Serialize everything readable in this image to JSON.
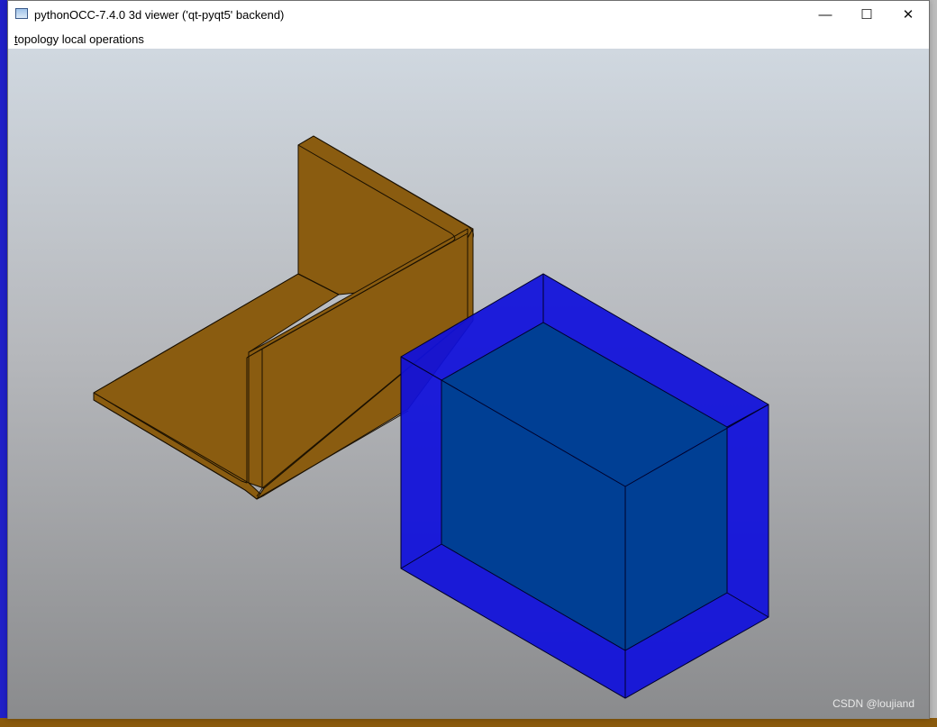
{
  "window": {
    "title": "pythonOCC-7.4.0 3d viewer ('qt-pyqt5' backend)",
    "controls": {
      "minimize": "—",
      "maximize": "☐",
      "close": "✕"
    }
  },
  "menubar": {
    "items": [
      {
        "mnemonic": "t",
        "rest": "opology local operations"
      }
    ]
  },
  "viewport": {
    "colors": {
      "bracket_face": "#8a5c10",
      "bracket_edge": "#1a1000",
      "box_outer": "#1010dc",
      "box_inner": "#003f94",
      "box_edge": "#00002a"
    }
  },
  "watermark": "CSDN @loujiand"
}
